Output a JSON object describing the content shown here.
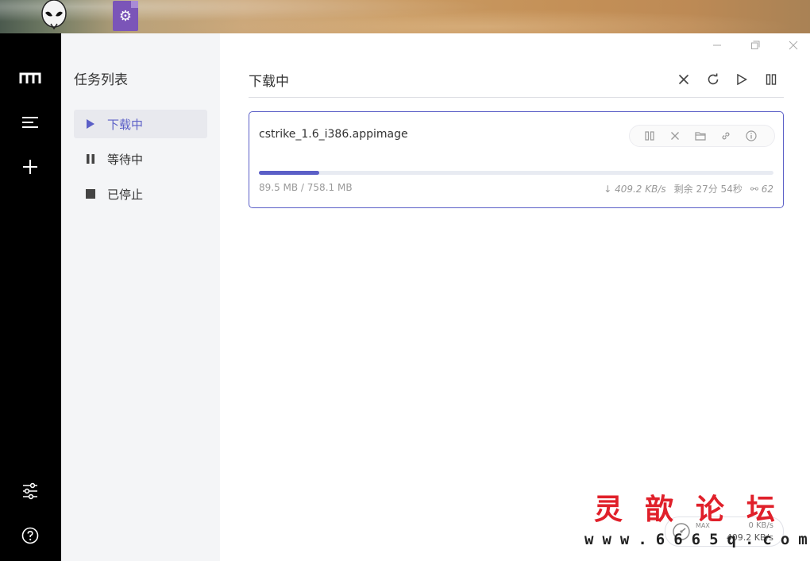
{
  "desktop": {
    "icons": [
      {
        "name": "alien-app-icon"
      },
      {
        "name": "settings-document-icon"
      }
    ]
  },
  "rail": {
    "items": [
      {
        "icon": "logo-icon"
      },
      {
        "icon": "menu-icon"
      },
      {
        "icon": "plus-icon"
      },
      {
        "icon": "sliders-icon"
      },
      {
        "icon": "help-icon"
      }
    ]
  },
  "sidebar": {
    "title": "任务列表",
    "items": [
      {
        "label": "下载中",
        "icon": "play-icon",
        "active": true
      },
      {
        "label": "等待中",
        "icon": "pause-icon",
        "active": false
      },
      {
        "label": "已停止",
        "icon": "stop-icon",
        "active": false
      }
    ]
  },
  "main": {
    "title": "下载中",
    "header_actions": [
      "close-icon",
      "refresh-icon",
      "play-icon",
      "pause-icon"
    ]
  },
  "task": {
    "name": "cstrike_1.6_i386.appimage",
    "progress_fraction": 0.118,
    "size": "89.5 MB / 758.1 MB",
    "speed": "↓ 409.2 KB/s",
    "remaining": "剩余 27分 54秒",
    "connections": "62",
    "actions": [
      "pause-icon",
      "delete-icon",
      "folder-icon",
      "link-icon",
      "info-icon"
    ]
  },
  "speed_meter": {
    "max_label": "MAX",
    "upload": "0 KB/s",
    "download": "409.2 KB/s"
  },
  "watermark": {
    "chars": [
      "灵",
      "歆",
      "论",
      "坛"
    ],
    "url": "www.6665q.com"
  },
  "colors": {
    "accent": "#5b5fc7",
    "rail": "#000000",
    "sidebar_bg": "#f4f5f7",
    "watermark_red": "#e0202a"
  }
}
